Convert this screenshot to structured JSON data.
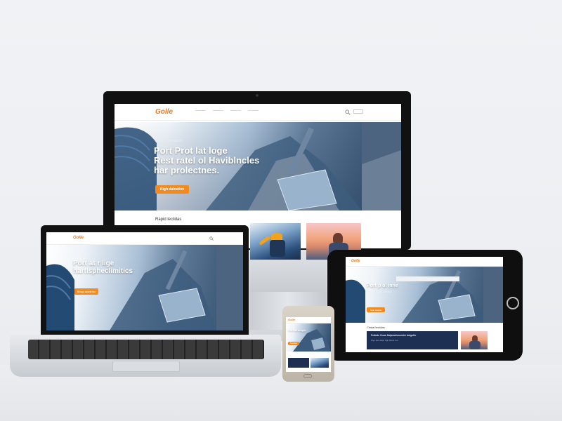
{
  "brand": {
    "logo": "Golle",
    "accent": "#f28a1e"
  },
  "desktop": {
    "nav_links": [
      "———",
      "———",
      "———",
      "———"
    ],
    "hero_kicker": "Nagyo, svo glicor",
    "hero_title": [
      "Port Prot lat loge",
      "Rest ratel ol Haviblncles",
      "har prolectnes."
    ],
    "cta": "Kigh dalnetive",
    "section_heading": "Rapid leclidas"
  },
  "laptop": {
    "hero_title": [
      "Port at r lige",
      "harflspheclimitics"
    ],
    "cta": "Shop doetrive"
  },
  "tablet": {
    "hero_title": "Port p ol inne",
    "hero_sub": "Reat laaphia lavtors",
    "cta": "Sbal doorle",
    "section_heading": "Cristal leclidas",
    "card_title": "Fedralo Huuo Haipeutemoenhe bolgulte",
    "card_sub": "Wyo phe dlote frgh tinelo vxo"
  },
  "phone": {
    "hero_title": "Port at ologic",
    "cta": "Apedone"
  }
}
